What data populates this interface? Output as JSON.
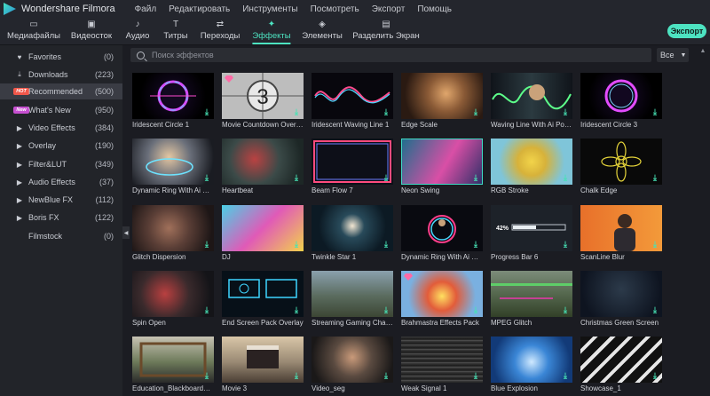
{
  "app": {
    "title": "Wondershare Filmora"
  },
  "menu": [
    "Файл",
    "Редактировать",
    "Инструменты",
    "Посмотреть",
    "Экспорт",
    "Помощь"
  ],
  "toolbar": {
    "tabs": [
      {
        "label": "Медиафайлы",
        "icon": "folder-icon"
      },
      {
        "label": "Видеосток",
        "icon": "stock-video-icon"
      },
      {
        "label": "Аудио",
        "icon": "music-note-icon"
      },
      {
        "label": "Титры",
        "icon": "text-icon"
      },
      {
        "label": "Переходы",
        "icon": "transition-icon"
      },
      {
        "label": "Эффекты",
        "icon": "effects-icon",
        "active": true
      },
      {
        "label": "Элементы",
        "icon": "elements-icon"
      },
      {
        "label": "Разделить Экран",
        "icon": "split-screen-icon"
      }
    ],
    "export_label": "Экспорт"
  },
  "sidebar": {
    "items": [
      {
        "label": "Favorites",
        "count": "(0)",
        "icon": "heart-icon"
      },
      {
        "label": "Downloads",
        "count": "(223)",
        "icon": "download-icon"
      },
      {
        "label": "Recommended",
        "count": "(500)",
        "badge": "HOT",
        "selected": true
      },
      {
        "label": "What's New",
        "count": "(950)",
        "badge": "New"
      },
      {
        "label": "Video Effects",
        "count": "(384)",
        "icon": "expand-arrow-icon"
      },
      {
        "label": "Overlay",
        "count": "(190)",
        "icon": "expand-arrow-icon"
      },
      {
        "label": "Filter&LUT",
        "count": "(349)",
        "icon": "expand-arrow-icon"
      },
      {
        "label": "Audio Effects",
        "count": "(37)",
        "icon": "expand-arrow-icon"
      },
      {
        "label": "NewBlue FX",
        "count": "(112)",
        "icon": "expand-arrow-icon"
      },
      {
        "label": "Boris FX",
        "count": "(122)",
        "icon": "expand-arrow-icon"
      },
      {
        "label": "Filmstock",
        "count": "(0)"
      }
    ]
  },
  "search": {
    "placeholder": "Поиск эффектов"
  },
  "filter": {
    "value": "Все"
  },
  "effects": [
    "Iridescent Circle 1",
    "Movie Countdown Overlay",
    "Iridescent Waving Line 1",
    "Edge Scale",
    "Waving Line With Ai Portrait",
    "Iridescent Circle 3",
    "Dynamic Ring With Ai Portrait",
    "Heartbeat",
    "Beam Flow 7",
    "Neon Swing",
    "RGB Stroke",
    "Chalk Edge",
    "Glitch Dispersion",
    "DJ",
    "Twinkle Star 1",
    "Dynamic Ring With Ai Portrait",
    "Progress Bar 6",
    "ScanLine Blur",
    "Spin Open",
    "End Screen Pack Overlay",
    "Streaming Gaming Channel",
    "Brahmastra Effects Pack",
    "MPEG Glitch",
    "Christmas Green Screen",
    "Education_Blackboard_Pack",
    "Movie 3",
    "Video_seg",
    "Weak Signal 1",
    "Blue Explosion",
    "Showcase_1"
  ],
  "thumb_text": {
    "countdown": "3",
    "progress": "42%"
  },
  "colors": {
    "accent": "#4de3c1",
    "download": "#47e3b5",
    "hot": "#f0574a",
    "new": "#c64fd0"
  }
}
